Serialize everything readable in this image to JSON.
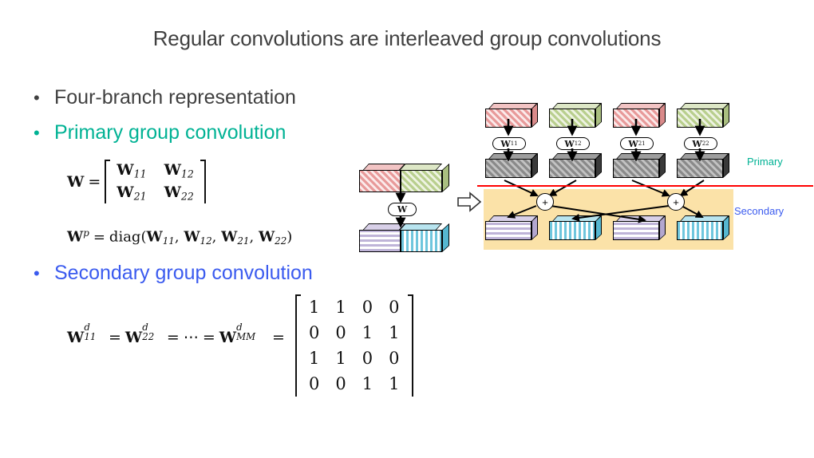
{
  "slide": {
    "title": "Regular convolutions are interleaved group convolutions",
    "title_color": "#404040",
    "background": "#ffffff"
  },
  "bullets": [
    {
      "marker": "•",
      "text": "Four-branch representation",
      "color": "#404040"
    },
    {
      "marker": "•",
      "text": "Primary group convolution",
      "color": "#00B294"
    },
    {
      "marker": "•",
      "text": "Secondary group convolution",
      "color": "#3B5BEF"
    }
  ],
  "formulas": {
    "matrix_w": {
      "lhs": "W",
      "equals": "=",
      "cells": [
        [
          "W",
          "11"
        ],
        [
          "W",
          "12"
        ],
        [
          "W",
          "21"
        ],
        [
          "W",
          "22"
        ]
      ]
    },
    "diag": {
      "lhs_base": "W",
      "lhs_sup": "p",
      "equals": "=",
      "fn": "diag",
      "open": "(",
      "args": [
        [
          "W",
          "11"
        ],
        [
          "W",
          "12"
        ],
        [
          "W",
          "21"
        ],
        [
          "W",
          "22"
        ]
      ],
      "comma": ",",
      "close": ")"
    },
    "secondary": {
      "terms": [
        {
          "base": "W",
          "sup": "d",
          "sub": "11"
        },
        {
          "base": "W",
          "sup": "d",
          "sub": "22"
        },
        {
          "base": "W",
          "sup": "d",
          "sub": "MM"
        }
      ],
      "equals": "=",
      "dots": "⋯",
      "matrix": [
        [
          "1",
          "1",
          "0",
          "0"
        ],
        [
          "0",
          "0",
          "1",
          "1"
        ],
        [
          "1",
          "1",
          "0",
          "0"
        ],
        [
          "0",
          "0",
          "1",
          "1"
        ]
      ]
    }
  },
  "diagram_left": {
    "input_box": {
      "left_fill": "hatch-red",
      "right_fill": "hatch-green"
    },
    "weight_label": {
      "base": "W",
      "sub": ""
    },
    "output_box": {
      "left_fill": "stripe-purple",
      "right_fill": "stripe-cyan"
    },
    "transform_arrow": "⇒"
  },
  "diagram_right": {
    "branches": [
      {
        "input_fill": "hatch-red",
        "weight_base": "W",
        "weight_sub": "11",
        "mid_fill": "hatch-gray",
        "output_fill": "stripe-purple"
      },
      {
        "input_fill": "hatch-green",
        "weight_base": "W",
        "weight_sub": "12",
        "mid_fill": "hatch-gray",
        "output_fill": "stripe-cyan"
      },
      {
        "input_fill": "hatch-red",
        "weight_base": "W",
        "weight_sub": "21",
        "mid_fill": "hatch-gray",
        "output_fill": "stripe-purple"
      },
      {
        "input_fill": "hatch-green",
        "weight_base": "W",
        "weight_sub": "22",
        "mid_fill": "hatch-gray",
        "output_fill": "stripe-cyan"
      }
    ],
    "adders": [
      {
        "symbol": "+"
      },
      {
        "symbol": "+"
      }
    ],
    "region_labels": {
      "primary": "Primary",
      "primary_color": "#00B294",
      "secondary": "Secondary",
      "secondary_color": "#3B5BEF"
    },
    "divider_color": "#ff0000",
    "secondary_region_color": "#fbe2a8"
  }
}
